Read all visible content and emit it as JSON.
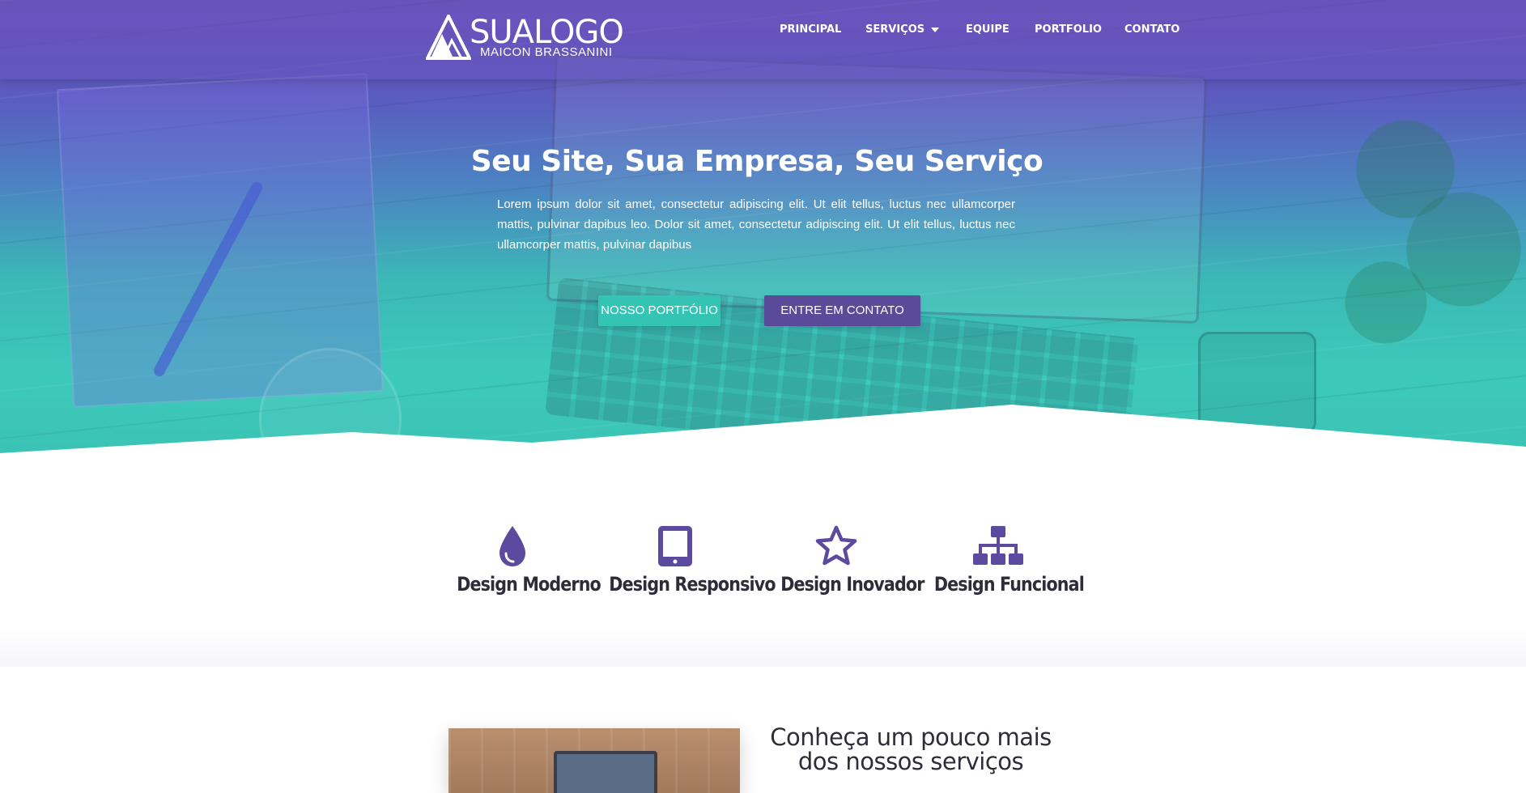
{
  "header": {
    "logo_title": "SUALOGO",
    "logo_subtitle": "MAICON BRASSANINI",
    "nav": [
      {
        "label": "PRINCIPAL"
      },
      {
        "label": "SERVIÇOS",
        "has_dropdown": true
      },
      {
        "label": "EQUIPE"
      },
      {
        "label": "PORTFOLIO"
      },
      {
        "label": "CONTATO"
      }
    ]
  },
  "hero": {
    "title": "Seu Site, Sua Empresa, Seu Serviço",
    "text": "Lorem ipsum dolor sit amet, consectetur adipiscing elit. Ut elit tellus, luctus nec ullamcorper mattis, pulvinar dapibus leo. Dolor sit amet, consectetur adipiscing elit. Ut elit tellus, luctus nec ullamcorper mattis, pulvinar dapibus",
    "btn_portfolio": "NOSSO PORTFÓLIO",
    "btn_contact": "ENTRE EM CONTATO"
  },
  "features": [
    {
      "label": "Design Moderno",
      "icon": "drop-icon"
    },
    {
      "label": "Design Responsivo",
      "icon": "tablet-icon"
    },
    {
      "label": "Design Inovador",
      "icon": "star-icon"
    },
    {
      "label": "Design Funcional",
      "icon": "sitemap-icon"
    }
  ],
  "about": {
    "title_line1": "Conheça um pouco mais",
    "title_line2": "dos nossos serviços"
  },
  "colors": {
    "brand_purple": "#5a4a9a",
    "accent_teal": "#34c4b4",
    "icon_purple": "#5b4a9e",
    "text_dark": "#2d2d3a"
  }
}
